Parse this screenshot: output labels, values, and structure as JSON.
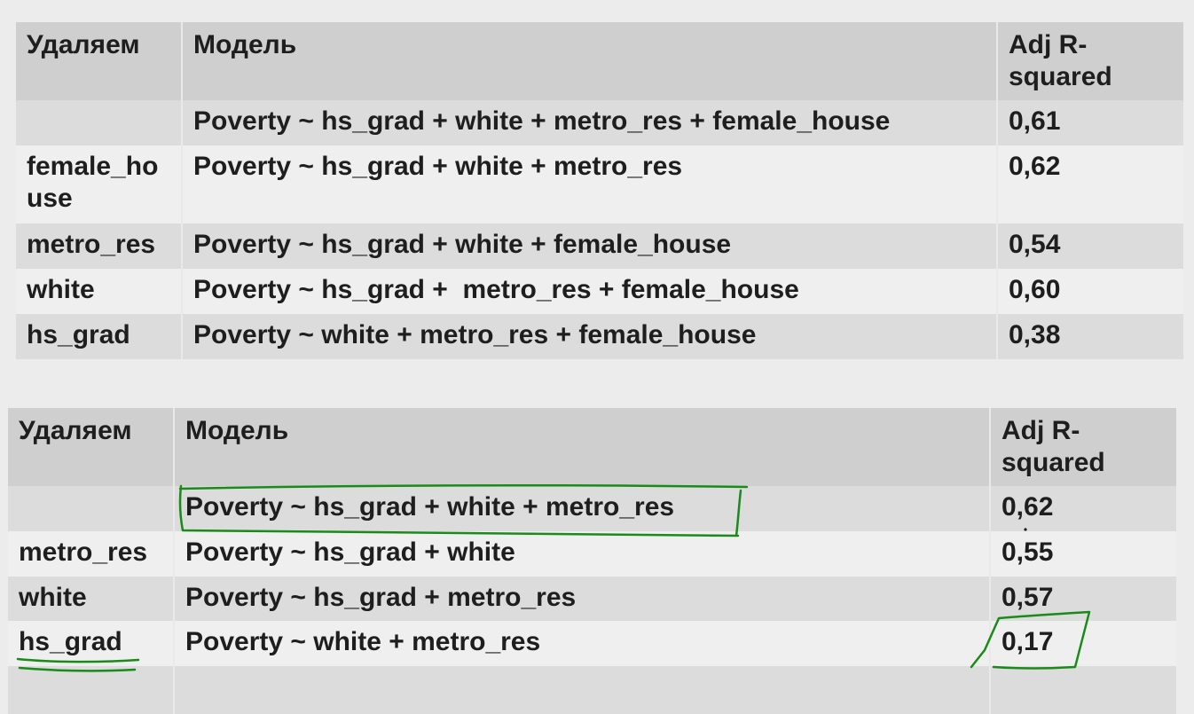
{
  "colors": {
    "header": "#cfcfcf",
    "row_dark": "#dcdcdc",
    "row_light": "#efefef",
    "ink": "#1a8a1a"
  },
  "table1": {
    "headers": {
      "remove": "Удаляем",
      "model": "Модель",
      "adj": "Adj R-squared"
    },
    "rows": [
      {
        "remove": "",
        "model": "Poverty ~ hs_grad + white + metro_res + female_house",
        "adj": "0,61"
      },
      {
        "remove": "female_house",
        "model": "Poverty ~ hs_grad + white + metro_res",
        "adj": "0,62"
      },
      {
        "remove": "metro_res",
        "model": "Poverty ~ hs_grad + white + female_house",
        "adj": "0,54"
      },
      {
        "remove": "white",
        "model": "Poverty ~ hs_grad +  metro_res + female_house",
        "adj": "0,60"
      },
      {
        "remove": "hs_grad",
        "model": "Poverty ~ white + metro_res + female_house",
        "adj": "0,38"
      }
    ]
  },
  "table2": {
    "headers": {
      "remove": "Удаляем",
      "model": "Модель",
      "adj": "Adj R-squared"
    },
    "rows": [
      {
        "remove": "",
        "model": "Poverty ~ hs_grad + white + metro_res",
        "adj": "0,62"
      },
      {
        "remove": "metro_res",
        "model": "Poverty ~ hs_grad + white",
        "adj": "0,55"
      },
      {
        "remove": "white",
        "model": "Poverty ~ hs_grad + metro_res",
        "adj": "0,57"
      },
      {
        "remove": "hs_grad",
        "model": "Poverty ~ white + metro_res",
        "adj": "0,17"
      }
    ]
  }
}
